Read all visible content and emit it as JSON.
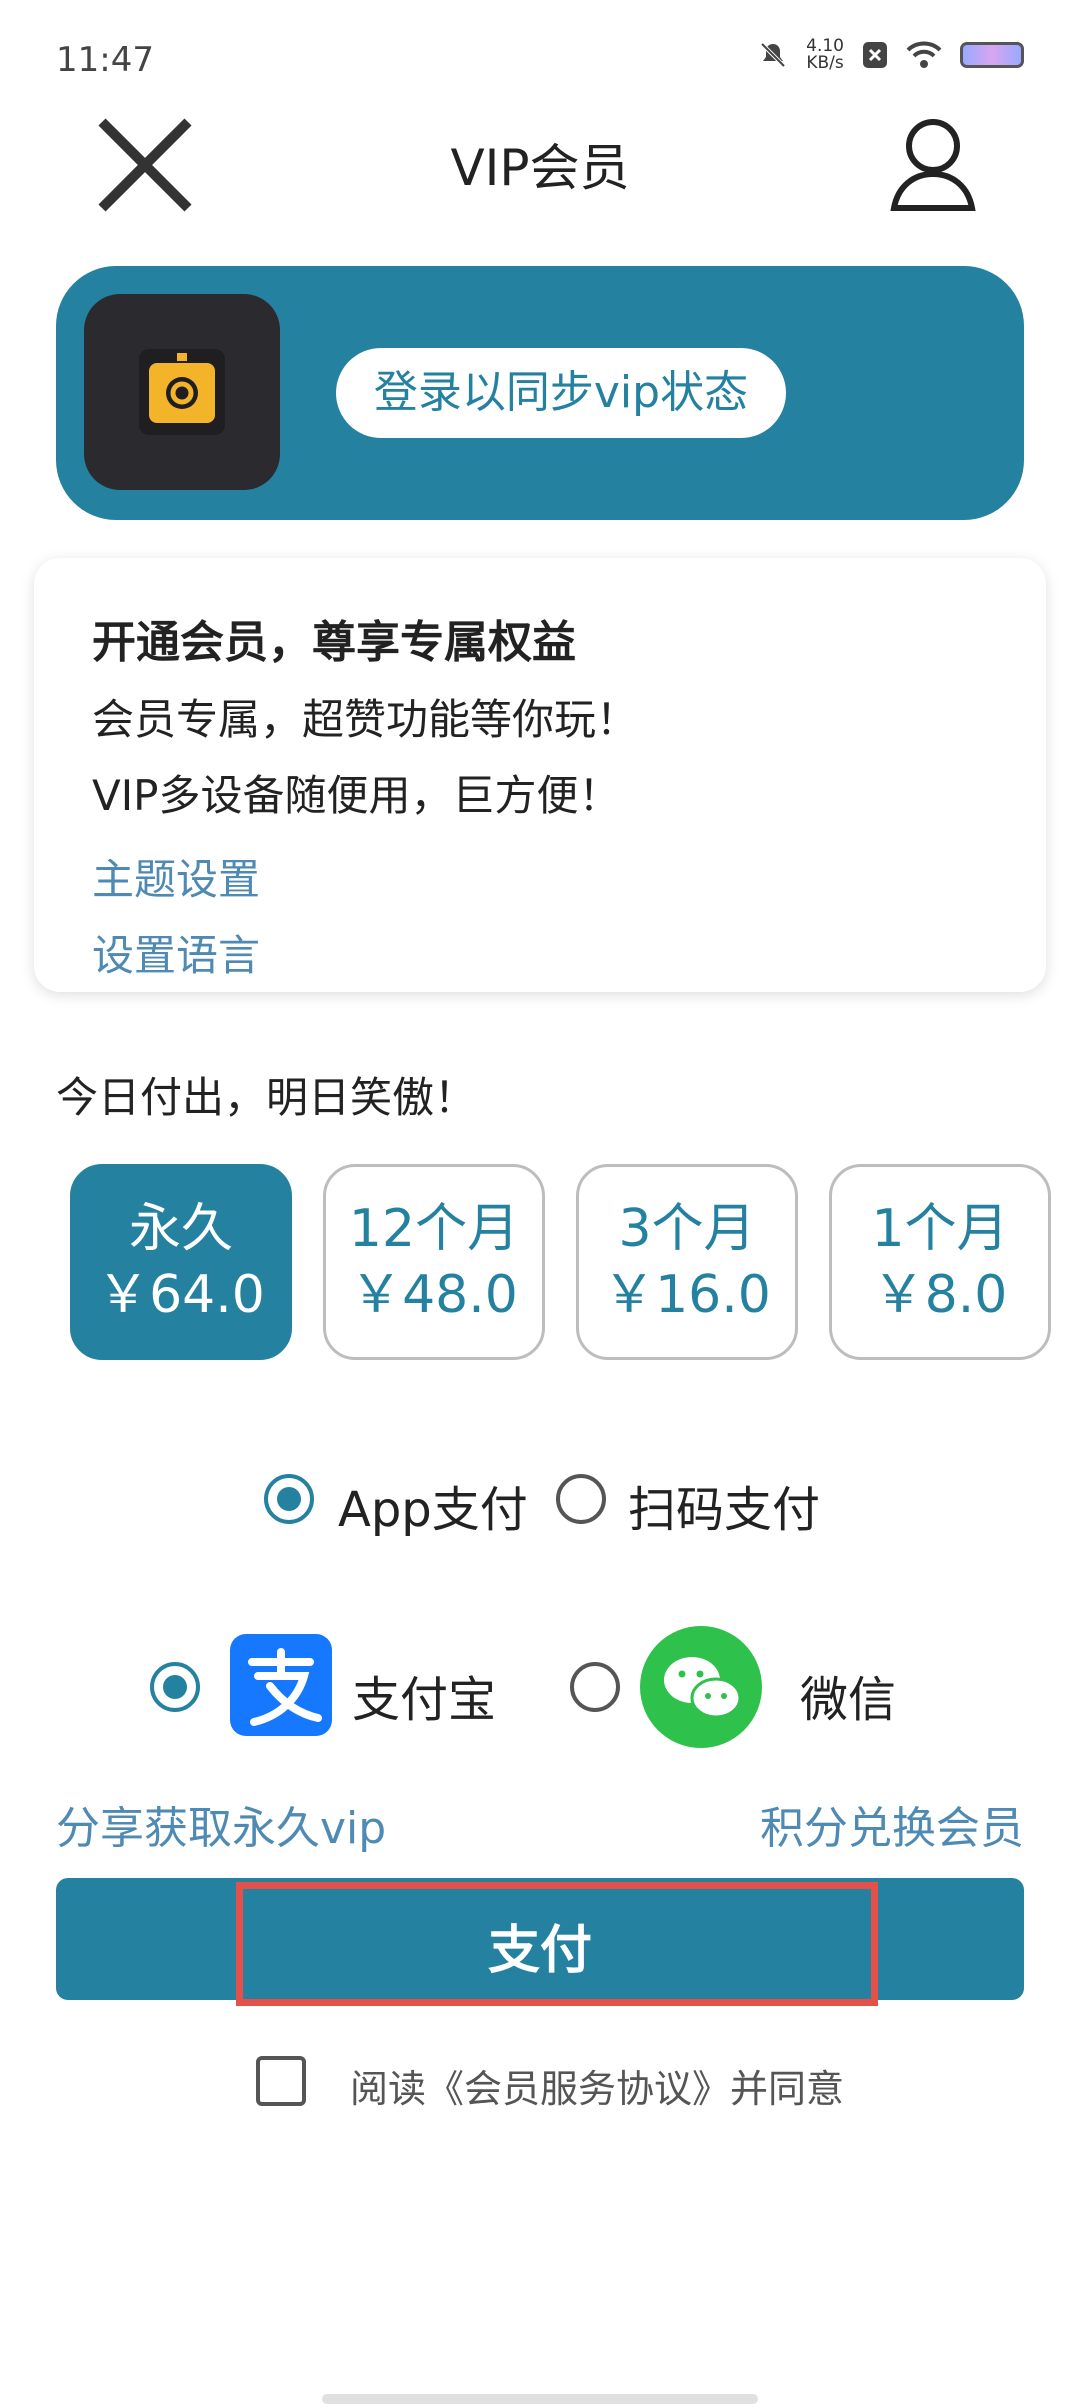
{
  "status_bar": {
    "time": "11:47",
    "net_speed_value": "4.10",
    "net_speed_unit": "KB/s"
  },
  "header": {
    "title": "VIP会员",
    "close_icon": "close-icon",
    "profile_icon": "user-icon"
  },
  "banner": {
    "login_label": "登录以同步vip状态",
    "bg_color": "#2581a0"
  },
  "card": {
    "title": "开通会员，尊享专属权益",
    "line1": "会员专属，超赞功能等你玩！",
    "line2": "VIP多设备随便用，巨方便！",
    "link1": "主题设置",
    "link2": "设置语言"
  },
  "slogan": "今日付出，明日笑傲！",
  "plans": [
    {
      "name": "永久",
      "price": "￥64.0",
      "selected": true
    },
    {
      "name": "12个月",
      "price": "￥48.0",
      "selected": false
    },
    {
      "name": "3个月",
      "price": "￥16.0",
      "selected": false
    },
    {
      "name": "1个月",
      "price": "￥8.0",
      "selected": false
    }
  ],
  "pay_mode": {
    "app_label": "App支付",
    "scan_label": "扫码支付",
    "selected": "app"
  },
  "pay_channel": {
    "alipay_label": "支付宝",
    "wechat_label": "微信",
    "selected": "alipay"
  },
  "links": {
    "share": "分享获取永久vip",
    "points": "积分兑换会员"
  },
  "pay_button": {
    "label": "支付"
  },
  "agreement": {
    "text": "阅读《会员服务协议》并同意",
    "checked": false
  },
  "colors": {
    "accent": "#2581a0",
    "link": "#4e8ab3",
    "highlight": "#e4504a",
    "alipay": "#1677ff",
    "wechat": "#2ec24c"
  }
}
